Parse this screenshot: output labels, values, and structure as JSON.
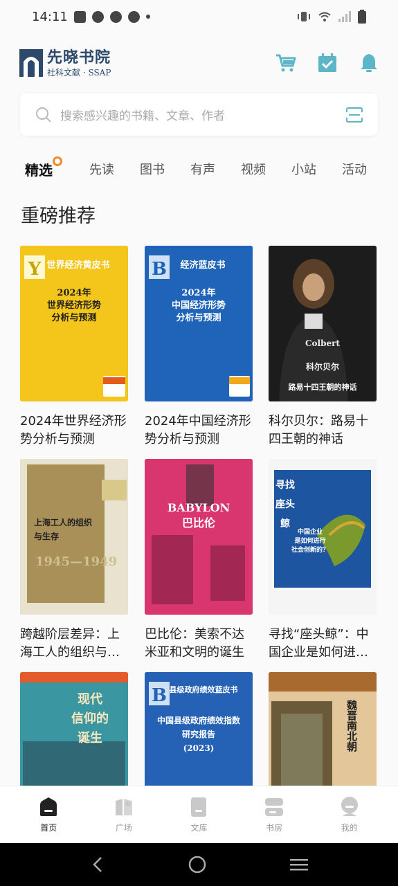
{
  "status_bar": {
    "time": "14:11"
  },
  "header": {
    "title": "先晓书院",
    "subtitle": "社科文献 · SSAP"
  },
  "search": {
    "placeholder": "搜索感兴趣的书籍、文章、作者"
  },
  "tabs": [
    {
      "label": "精选",
      "active": true
    },
    {
      "label": "先读"
    },
    {
      "label": "图书"
    },
    {
      "label": "有声"
    },
    {
      "label": "视频"
    },
    {
      "label": "小站"
    },
    {
      "label": "活动"
    }
  ],
  "section": {
    "title": "重磅推荐"
  },
  "books": [
    {
      "title": "2024年世界经济形势分析与预测",
      "cover": {
        "series": "世界经济黄皮书",
        "main": "2024年\n世界经济形势\n分析与预测"
      }
    },
    {
      "title": "2024年中国经济形势分析与预测",
      "cover": {
        "series": "经济蓝皮书",
        "main": "2024年\n中国经济形势\n分析与预测"
      }
    },
    {
      "title": "科尔贝尔：路易十四王朝的神话",
      "cover": {
        "main": "Colbert\n科尔贝尔",
        "sub": "路易十四王朝的神话"
      }
    },
    {
      "title": "跨越阶层差异：上海工人的组织与…",
      "cover": {
        "main": "上海工人的组织\n与生存",
        "sub": "1945—1949"
      }
    },
    {
      "title": "巴比伦：美索不达米亚和文明的诞生",
      "cover": {
        "main": "BABYLON\n巴比伦"
      }
    },
    {
      "title": "寻找“座头鲸”：中国企业是如何进…",
      "cover": {
        "main": "寻找\n座头鲸",
        "sub": "中国企业\n是如何进行\n社会创新的？"
      }
    },
    {
      "title": "",
      "cover": {
        "main": "现代\n信仰的\n诞生"
      }
    },
    {
      "title": "",
      "cover": {
        "series": "县级政府绩效蓝皮书",
        "main": "中国县级政府绩效指数\n研究报告\n(2023)"
      }
    },
    {
      "title": "",
      "cover": {
        "main": "魏晋南北朝"
      }
    }
  ],
  "bottom_nav": [
    {
      "label": "首页",
      "active": true
    },
    {
      "label": "广场"
    },
    {
      "label": "文库"
    },
    {
      "label": "书房"
    },
    {
      "label": "我的"
    }
  ],
  "colors": {
    "accent": "#f08a2a",
    "brand": "#2d4a6b"
  }
}
